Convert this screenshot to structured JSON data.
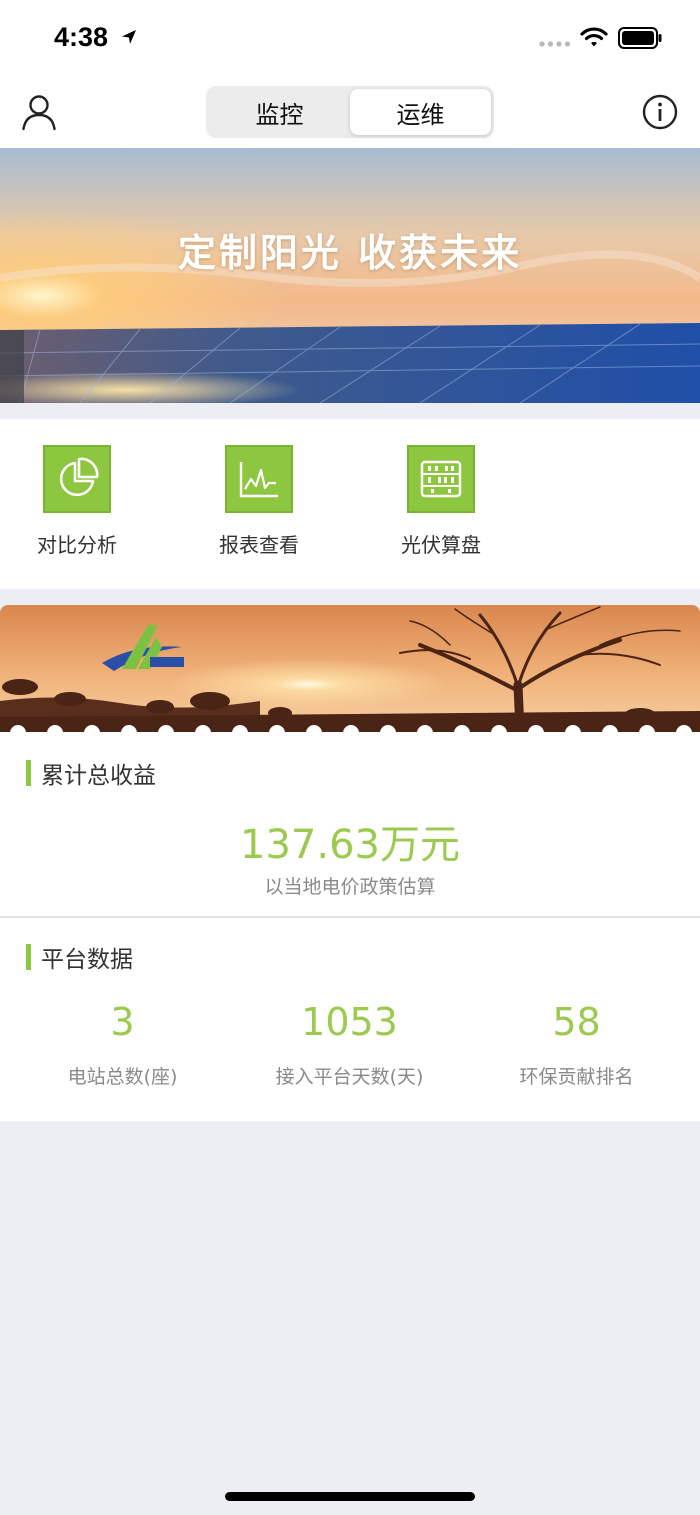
{
  "status_bar": {
    "time": "4:38"
  },
  "nav": {
    "tabs": [
      {
        "label": "监控",
        "active": false
      },
      {
        "label": "运维",
        "active": true
      }
    ]
  },
  "banner": {
    "slogan": "定制阳光 收获未来"
  },
  "quick_menu": {
    "items": [
      {
        "label": "对比分析",
        "icon": "pie-chart-icon"
      },
      {
        "label": "报表查看",
        "icon": "line-chart-icon"
      },
      {
        "label": "光伏算盘",
        "icon": "abacus-icon"
      }
    ]
  },
  "revenue": {
    "title": "累计总收益",
    "value": "137.63万元",
    "note": "以当地电价政策估算"
  },
  "platform": {
    "title": "平台数据",
    "stats": [
      {
        "value": "3",
        "label": "电站总数(座)"
      },
      {
        "value": "1053",
        "label": "接入平台天数(天)"
      },
      {
        "value": "58",
        "label": "环保贡献排名"
      }
    ]
  },
  "colors": {
    "accent_green": "#8dc63f",
    "value_green": "#9bcb4e"
  }
}
